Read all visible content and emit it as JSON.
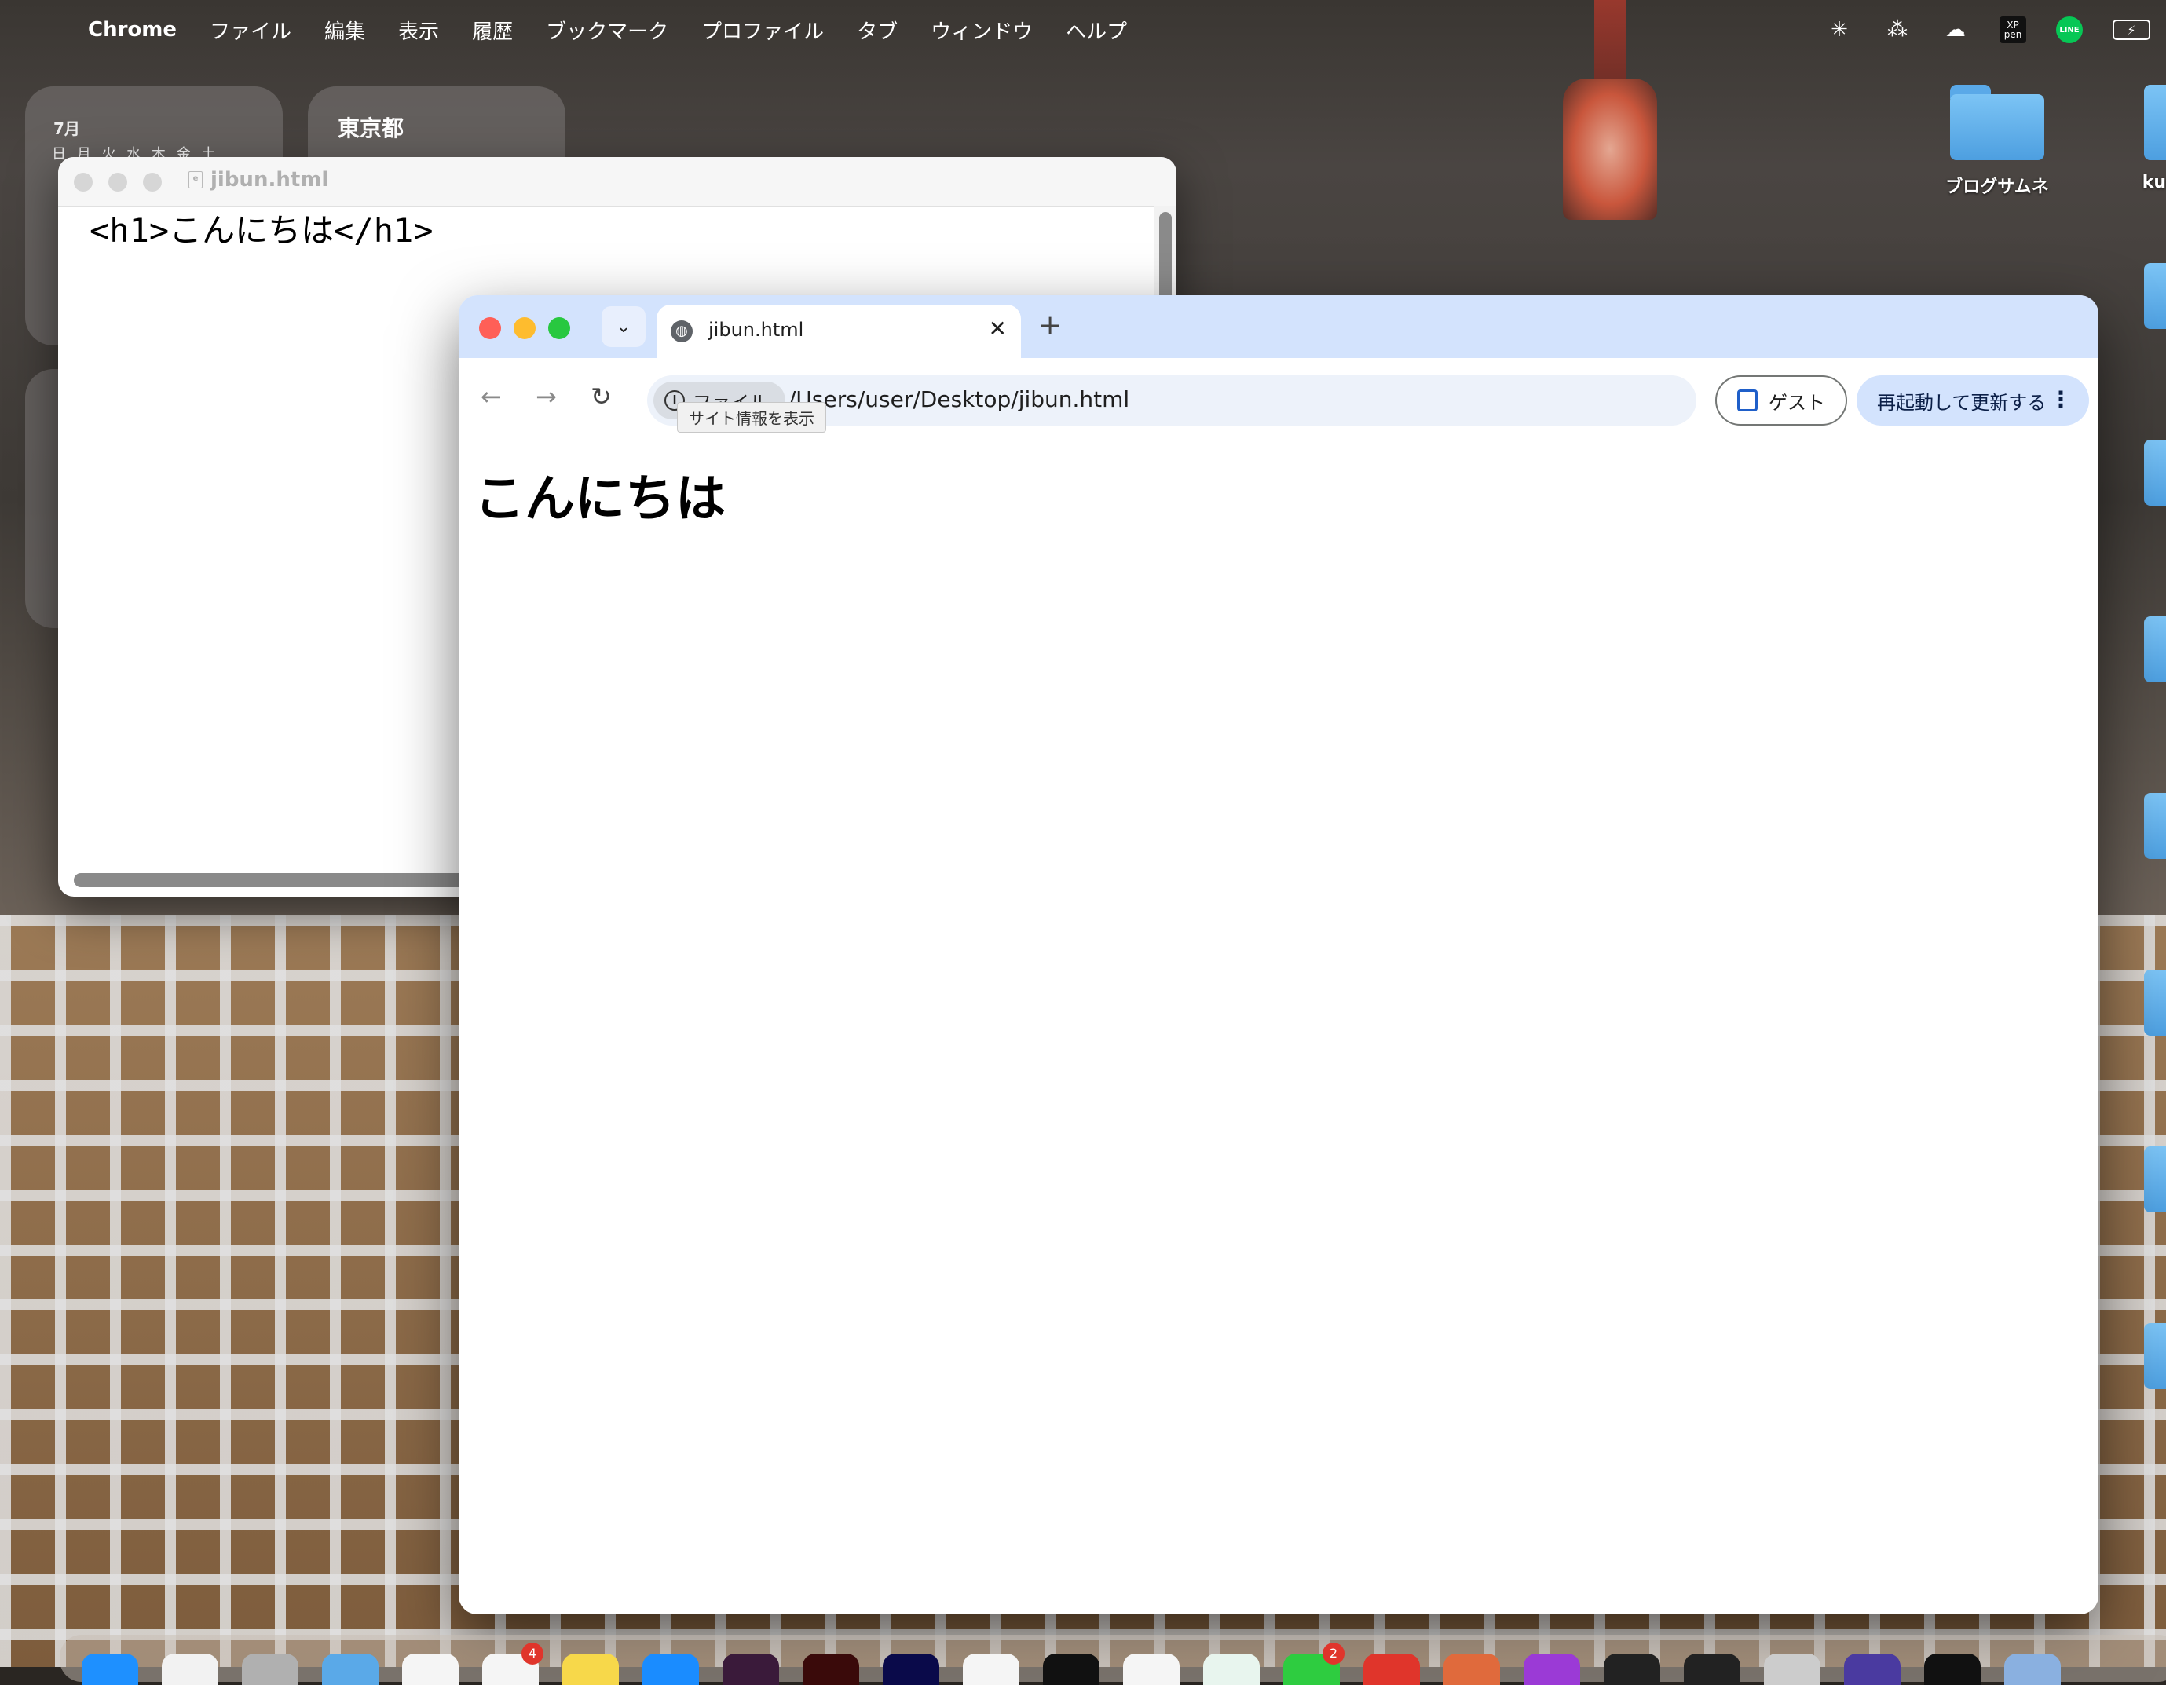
{
  "menubar": {
    "app_name": "Chrome",
    "items": [
      "ファイル",
      "編集",
      "表示",
      "履歴",
      "ブックマーク",
      "プロファイル",
      "タブ",
      "ウィンドウ",
      "ヘルプ"
    ],
    "status_icons": [
      "sparkle-icon",
      "figma-icon",
      "cloud-icon",
      "xp-pen-icon",
      "line-icon",
      "battery-icon"
    ],
    "xp_label": "XP pen",
    "line_label": "LINE"
  },
  "widgets": {
    "calendar_month": "7月",
    "calendar_days": "日 月 火 水 木 金 土",
    "weather_city": "東京都"
  },
  "desktop_icons": [
    {
      "label": "ブログサムネ"
    },
    {
      "label": "ku"
    }
  ],
  "editor": {
    "title": "jibun.html",
    "content": "<h1>こんにちは</h1>"
  },
  "chrome": {
    "tab_title": "jibun.html",
    "tab_close": "✕",
    "new_tab": "+",
    "chip_label": "ファイル",
    "url": "/Users/user/Desktop/jibun.html",
    "tooltip": "サイト情報を表示",
    "guest_label": "ゲスト",
    "restart_label": "再起動して更新する",
    "page_heading": "こんにちは"
  },
  "colors": {
    "tabstrip": "#d3e3fd",
    "omnibox": "#edf2fa",
    "close_red": "#ff5f57",
    "minimize_yellow": "#febc2e",
    "zoom_green": "#28c840"
  },
  "dock_badges": [
    "4",
    "2"
  ]
}
